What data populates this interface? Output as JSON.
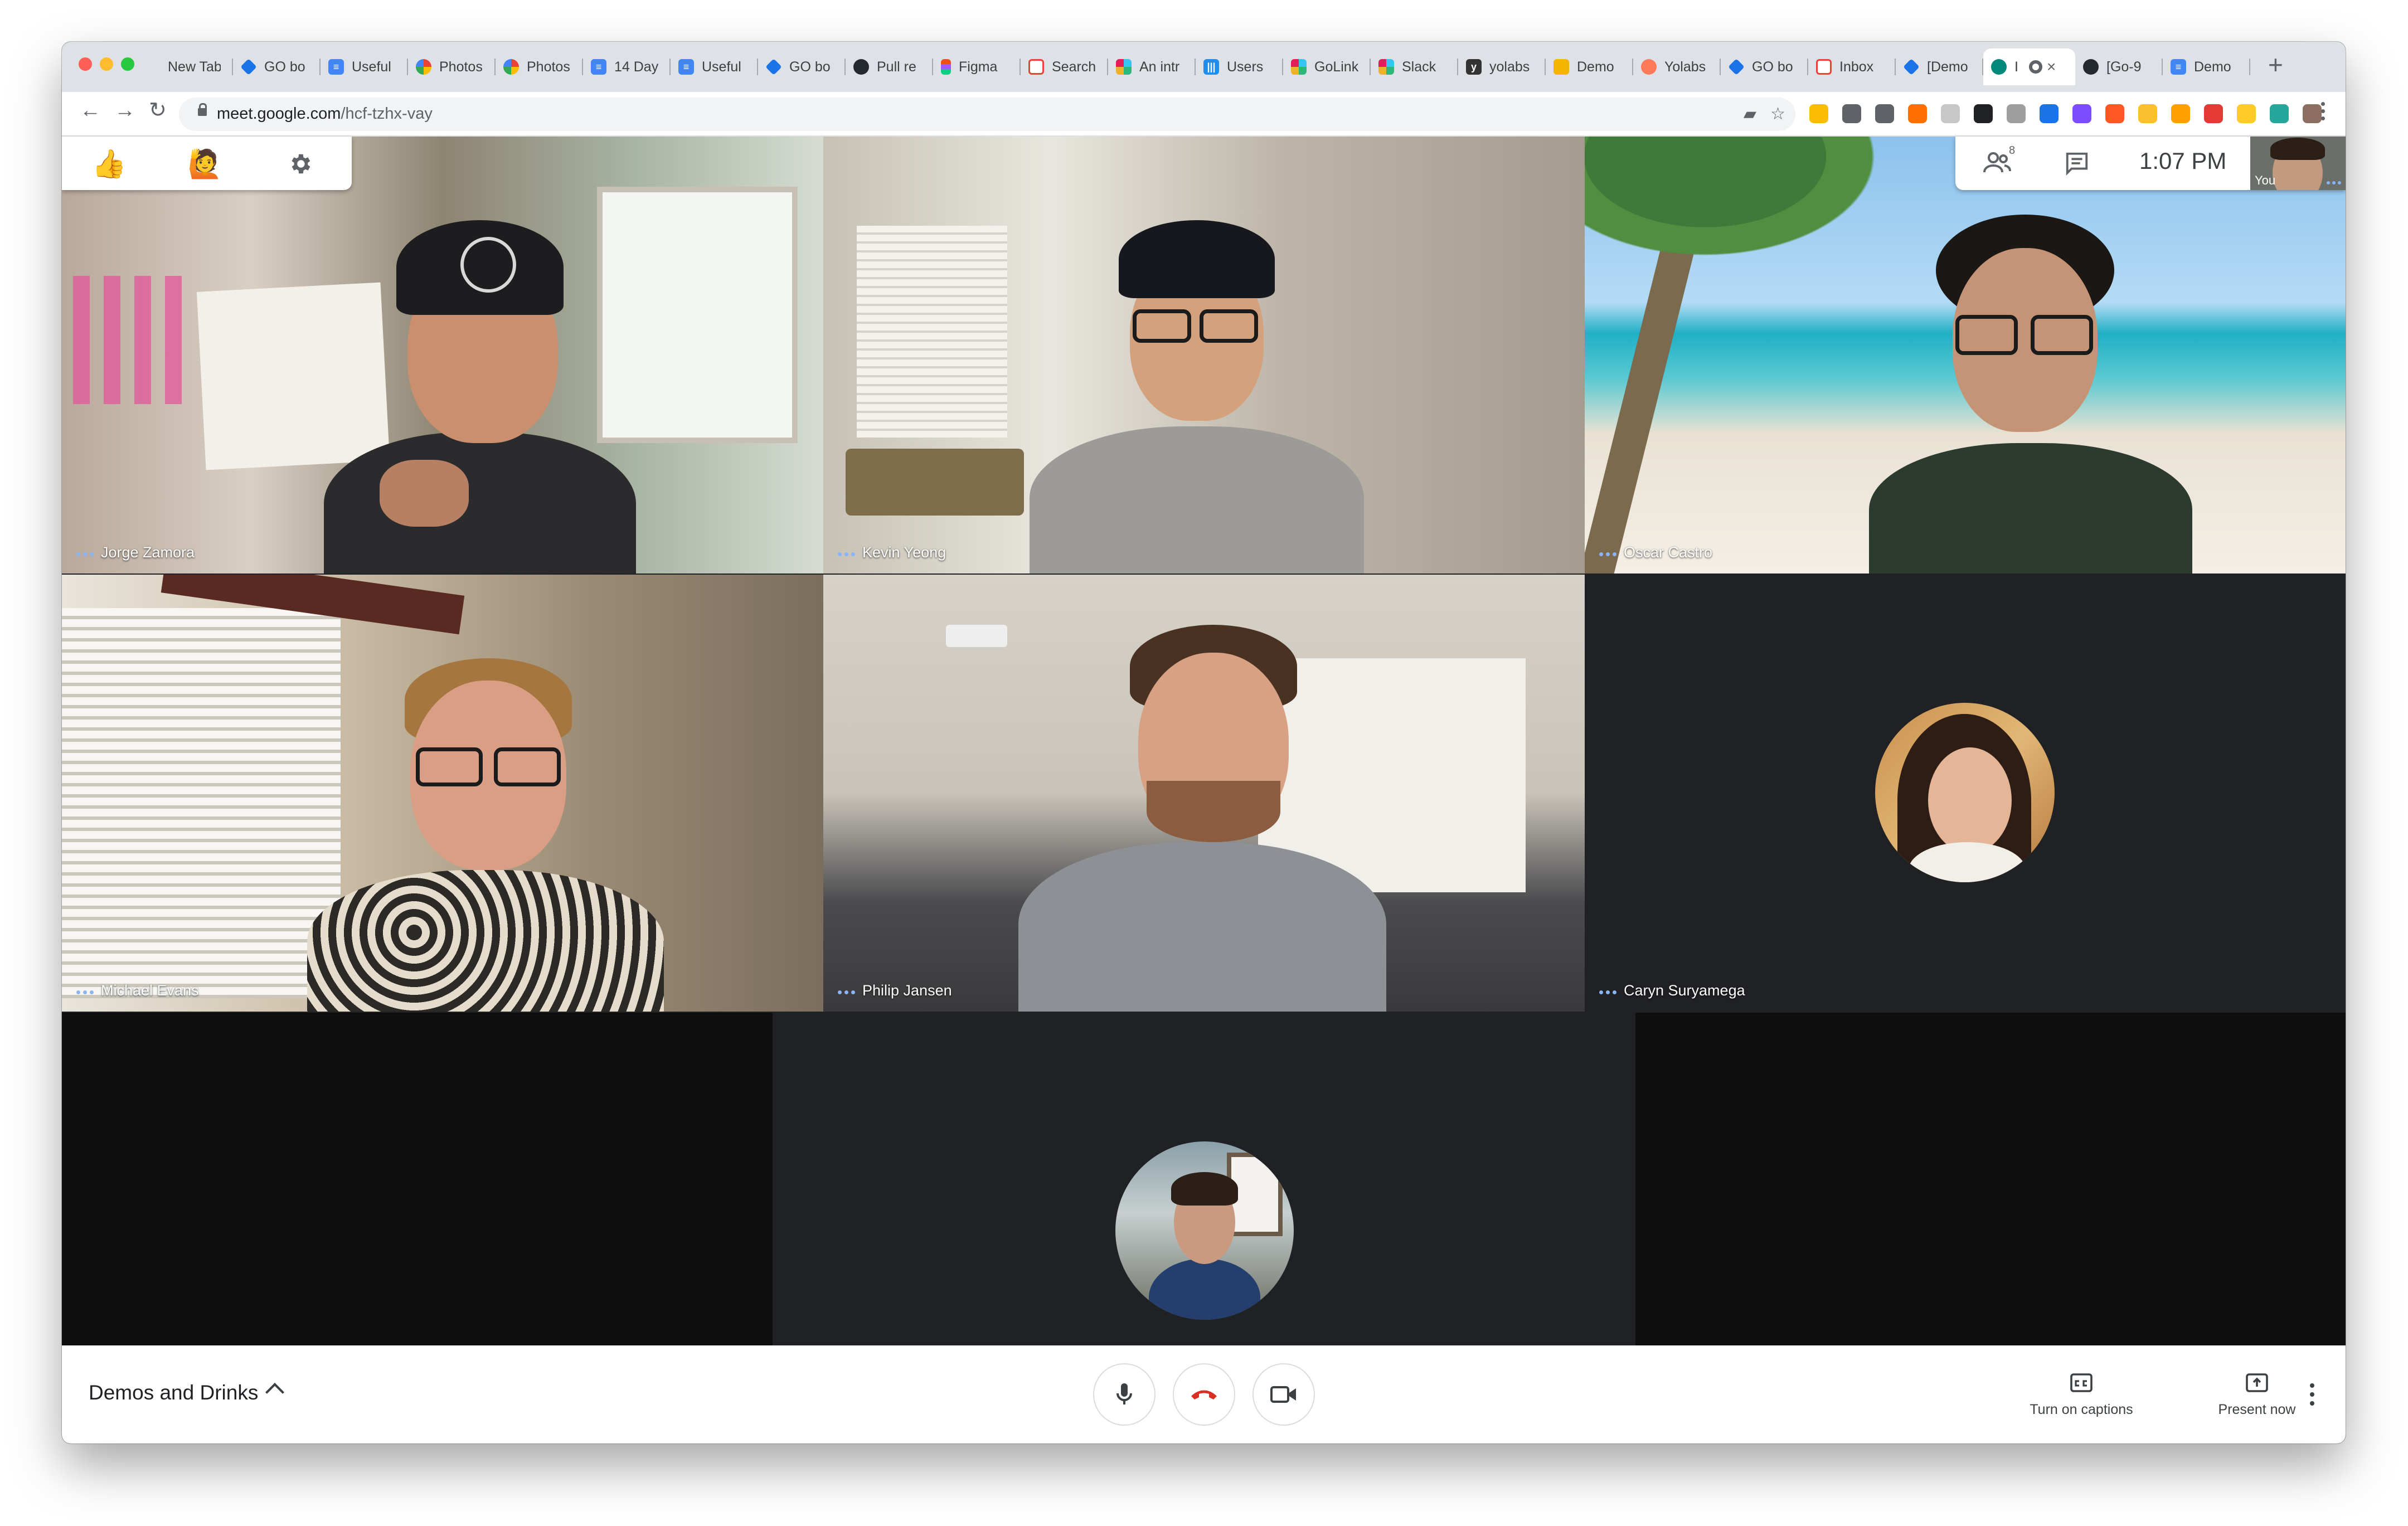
{
  "browser": {
    "tabs": [
      {
        "label": "New Tab",
        "icon": "none"
      },
      {
        "label": "GO bo",
        "icon": "diamond-icon",
        "color": "#1a73e8"
      },
      {
        "label": "Useful",
        "icon": "docs-icon",
        "color": "#4285f4"
      },
      {
        "label": "Photos",
        "icon": "photos-icon",
        "color": "#fbbc04"
      },
      {
        "label": "Photos",
        "icon": "photos-icon",
        "color": "#fbbc04"
      },
      {
        "label": "14 Day",
        "icon": "docs-icon",
        "color": "#4285f4"
      },
      {
        "label": "Useful",
        "icon": "docs-icon",
        "color": "#4285f4"
      },
      {
        "label": "GO bo",
        "icon": "diamond-icon",
        "color": "#1a73e8"
      },
      {
        "label": "Pull re",
        "icon": "github-icon",
        "color": "#24292e"
      },
      {
        "label": "Figma",
        "icon": "figma-icon",
        "color": "#f24e1e"
      },
      {
        "label": "Search",
        "icon": "gmail-icon",
        "color": "#ea4335"
      },
      {
        "label": "An intr",
        "icon": "slack-icon",
        "color": "#4a154b"
      },
      {
        "label": "Users",
        "icon": "intercom-icon",
        "color": "#1f8ded"
      },
      {
        "label": "GoLink",
        "icon": "slack-icon",
        "color": "#4a154b"
      },
      {
        "label": "Slack",
        "icon": "slack-icon",
        "color": "#4a154b"
      },
      {
        "label": "yolabs",
        "icon": "yolabs-icon",
        "color": "#333333"
      },
      {
        "label": "Demo",
        "icon": "slides-icon",
        "color": "#f4b400"
      },
      {
        "label": "Yolabs",
        "icon": "hubspot-icon",
        "color": "#ff7a59"
      },
      {
        "label": "GO bo",
        "icon": "diamond-icon",
        "color": "#1a73e8"
      },
      {
        "label": "Inbox",
        "icon": "gmail-icon",
        "color": "#ea4335"
      },
      {
        "label": "[Demo",
        "icon": "diamond-icon",
        "color": "#1a73e8"
      },
      {
        "label": "I",
        "icon": "meet-icon",
        "color": "#00897b",
        "active": true
      },
      {
        "label": "[Go-9",
        "icon": "github-icon",
        "color": "#24292e"
      },
      {
        "label": "Demo",
        "icon": "docs-icon",
        "color": "#4285f4"
      }
    ],
    "new_tab_symbol": "+",
    "close_symbol": "×",
    "url_host": "meet.google.com",
    "url_path": "/hcf-tzhx-vay",
    "extension_colors": [
      "#fbbc04",
      "#5f6368",
      "#5f6368",
      "#ff6f00",
      "#c7c7c7",
      "#202124",
      "#9e9e9e",
      "#1a73e8",
      "#7c4dff",
      "#ff5722",
      "#fbc02d",
      "#ffa000",
      "#e53935",
      "#ffca28",
      "#26a69a",
      "#8d6e63"
    ]
  },
  "meeting": {
    "title": "Demos and Drinks",
    "time": "1:07 PM",
    "participant_count_badge": "8",
    "self_label": "You",
    "participants": [
      {
        "name": "Jorge Zamora",
        "video": true
      },
      {
        "name": "Kevin Yeong",
        "video": true
      },
      {
        "name": "Oscar Castro",
        "video": true
      },
      {
        "name": "Michael Evans",
        "video": true
      },
      {
        "name": "Philip Jansen",
        "video": true
      },
      {
        "name": "Caryn Suryamega",
        "video": false
      }
    ],
    "reactions": {
      "thumbs_up": "👍",
      "raise_hand": "🙋"
    },
    "controls": {
      "captions_label": "Turn on captions",
      "present_label": "Present now"
    }
  }
}
